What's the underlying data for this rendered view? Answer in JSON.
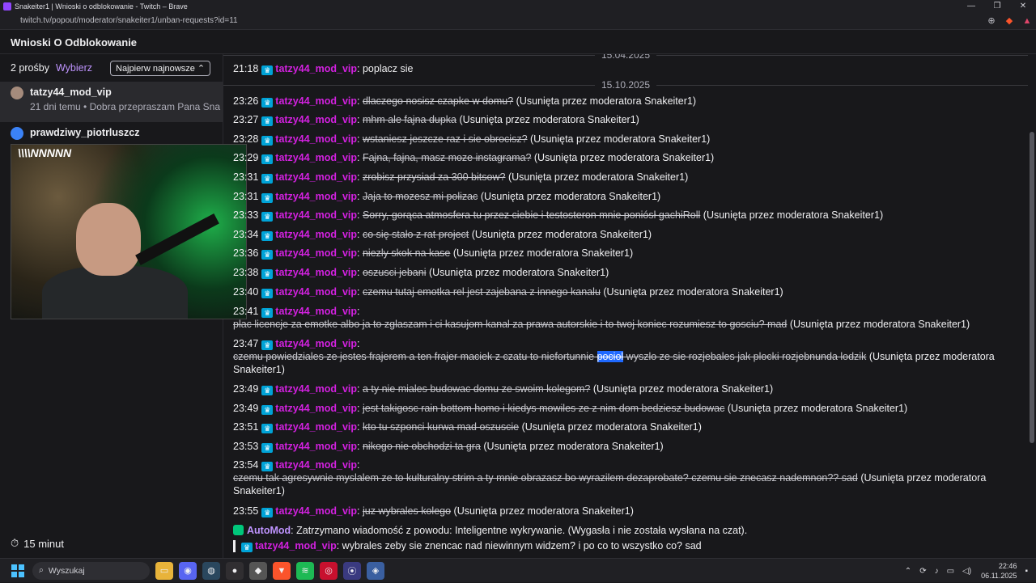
{
  "window": {
    "title": "Snakeiter1 | Wnioski o odblokowanie - Twitch – Brave",
    "url": "twitch.tv/popout/moderator/snakeiter1/unban-requests?id=11"
  },
  "header": {
    "title": "Wnioski O Odblokowanie"
  },
  "sidebar": {
    "count": "2 prośby",
    "select_label": "Wybierz",
    "sort_label": "Najpierw najnowsze ⌃",
    "requests": [
      {
        "name": "tatzy44_mod_vip",
        "meta": "21 dni temu • Dobra przepraszam Pana Sna"
      },
      {
        "name": "prawdziwy_piotrluszcz",
        "meta": ""
      }
    ],
    "webcam_logo": "\\\\\\\\NNNNN",
    "bottom_timer": "15 minut"
  },
  "chat": {
    "date_top": "15.04.2025",
    "date_sep": "15.10.2025",
    "mod_note": "(Usunięta przez moderatora Snakeiter1)",
    "user": "tatzy44_mod_vip",
    "messages": [
      {
        "time": "21:18",
        "text": "poplacz sie",
        "deleted": false
      },
      {
        "time": "23:26",
        "text": "dlaczego nosisz czapke w domu?",
        "deleted": true
      },
      {
        "time": "23:27",
        "text": "mhm ale fajna dupka",
        "deleted": true
      },
      {
        "time": "23:28",
        "text": "wstaniesz jeszcze raz i sie obrocisz?",
        "deleted": true
      },
      {
        "time": "23:29",
        "text": "Fajna, fajna, masz moze instagrama?",
        "deleted": true
      },
      {
        "time": "23:31",
        "text": "zrobisz przysiad za 300 bitsow?",
        "deleted": true
      },
      {
        "time": "23:31",
        "text": "Jaja to mozesz mi polizac",
        "deleted": true
      },
      {
        "time": "23:33",
        "text": "Sorry, gorąca atmosfera tu przez ciebie i testosteron mnie poniósł gachiRoll",
        "deleted": true
      },
      {
        "time": "23:34",
        "text": "co się stało z rat project",
        "deleted": true
      },
      {
        "time": "23:36",
        "text": "niezly skok na kase",
        "deleted": true
      },
      {
        "time": "23:38",
        "text": "oszusci jebani",
        "deleted": true
      },
      {
        "time": "23:40",
        "text": "czemu tutaj emotka rel jest zajebana z innego kanalu",
        "deleted": true
      },
      {
        "time": "23:41",
        "text": "plac licencje za emotke albo ja to zglaszam i ci kasujom kanal za prawa autorskie i to twoj koniec rozumiesz to gosciu? mad",
        "deleted": true
      },
      {
        "time": "23:47",
        "text_a": "czemu powiedziales ze jestes frajerem a ten frajer maciek z czatu to niefortunnie ",
        "text_hl": "pociol",
        "text_b": " wyszlo ze sie rozjebales jak plocki rozjebnunda lodzik",
        "deleted": true
      },
      {
        "time": "23:49",
        "text": "a ty nie miales budowac domu ze swoim kolegom?",
        "deleted": true
      },
      {
        "time": "23:49",
        "text": "jest takigosc rain bottom homo i kiedys mowiles ze z nim dom bedziesz budowac",
        "deleted": true
      },
      {
        "time": "23:51",
        "text": "kto tu szponci kurwa mad oszuscie",
        "deleted": true
      },
      {
        "time": "23:53",
        "text": "nikogo nie obchodzi ta gra",
        "deleted": true
      },
      {
        "time": "23:54",
        "text": "czemu tak agresywnie myslalem ze to kulturalny strim a ty mnie obrazasz bo wyrazilem dezaprobate? czemu sie znecasz nademnon?? sad",
        "deleted": true
      },
      {
        "time": "23:55",
        "text": "juz wybrales kolego",
        "deleted": true
      }
    ],
    "automod": {
      "name": "AutoMod",
      "text": ": Zatrzymano wiadomość z powodu: Inteligentne wykrywanie. (Wygasła i nie została wysłana na czat)."
    },
    "quoted": {
      "user": "tatzy44_mod_vip",
      "text": ": wybrales zeby sie znencac nad niewinnym widzem? i po co to wszystko co? sad"
    }
  },
  "taskbar": {
    "search_placeholder": "Wyszukaj",
    "time": "22:46",
    "date": "06.11.2025"
  },
  "colors": {
    "accent": "#bf94ff",
    "username": "#d321e0",
    "badge": "#00a3d7",
    "background": "#18181b"
  }
}
